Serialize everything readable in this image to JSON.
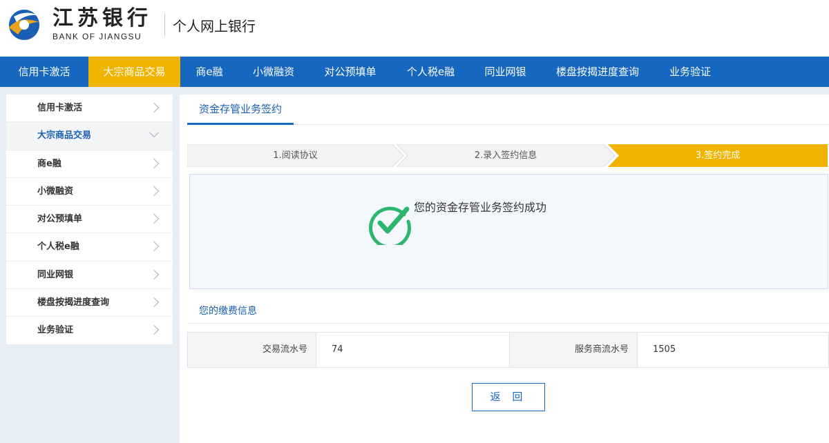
{
  "header": {
    "brand_cn": "江苏银行",
    "brand_en": "BANK OF JIANGSU",
    "title": "个人网上银行",
    "logo_icon": "bank-of-jiangsu-logo-icon"
  },
  "topnav": {
    "items": [
      {
        "label": "信用卡激活",
        "active": false
      },
      {
        "label": "大宗商品交易",
        "active": true
      },
      {
        "label": "商e融",
        "active": false
      },
      {
        "label": "小微融资",
        "active": false
      },
      {
        "label": "对公预填单",
        "active": false
      },
      {
        "label": "个人税e融",
        "active": false
      },
      {
        "label": "同业网银",
        "active": false
      },
      {
        "label": "楼盘按揭进度查询",
        "active": false
      },
      {
        "label": "业务验证",
        "active": false
      }
    ]
  },
  "sidebar": {
    "items": [
      {
        "label": "信用卡激活",
        "active": false
      },
      {
        "label": "大宗商品交易",
        "active": true
      },
      {
        "label": "商e融",
        "active": false
      },
      {
        "label": "小微融资",
        "active": false
      },
      {
        "label": "对公预填单",
        "active": false
      },
      {
        "label": "个人税e融",
        "active": false
      },
      {
        "label": "同业网银",
        "active": false
      },
      {
        "label": "楼盘按揭进度查询",
        "active": false
      },
      {
        "label": "业务验证",
        "active": false
      }
    ]
  },
  "main": {
    "tab": "资金存管业务签约",
    "steps": [
      {
        "label": "1.阅读协议",
        "state": "done"
      },
      {
        "label": "2.录入签约信息",
        "state": "done"
      },
      {
        "label": "3.签约完成",
        "state": "current"
      }
    ],
    "success_message": "您的资金存管业务签约成功",
    "success_icon": "check-circle-icon",
    "section_title": "您的缴费信息",
    "info": [
      {
        "label": "交易流水号",
        "value": "74"
      },
      {
        "label": "服务商流水号",
        "value": "1505"
      }
    ],
    "return_button": "返 回"
  },
  "colors": {
    "primary_blue": "#1567c0",
    "accent_yellow": "#f0b400",
    "success_green": "#2db66e",
    "page_bg": "#e8eef5"
  }
}
